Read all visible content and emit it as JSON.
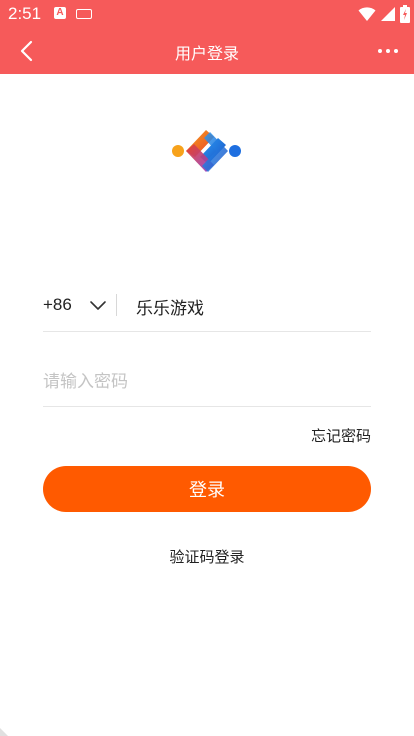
{
  "status_bar": {
    "time": "2:51",
    "notification_badge": "A",
    "icons": [
      "notification-a-icon",
      "keyboard-icon",
      "wifi-icon",
      "signal-icon",
      "battery-icon"
    ]
  },
  "app_bar": {
    "title": "用户登录",
    "back_icon": "chevron-left-icon",
    "more_icon": "more-dots-icon"
  },
  "colors": {
    "app_bar": "#F65A5A",
    "primary_button": "#FF5A00",
    "logo_gradient": [
      "#F7A21B",
      "#E8402A",
      "#1E88E5"
    ]
  },
  "logo": {
    "icon": "app-logo"
  },
  "form": {
    "country_code": "+86",
    "phone_value": "乐乐游戏",
    "password_placeholder": "请输入密码",
    "forgot_password": "忘记密码",
    "login_button": "登录",
    "code_login": "验证码登录"
  }
}
